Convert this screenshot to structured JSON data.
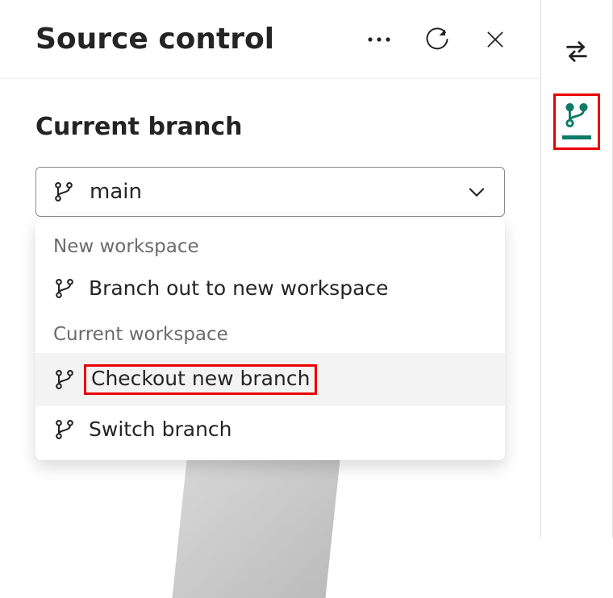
{
  "header": {
    "title": "Source control"
  },
  "section": {
    "heading": "Current branch"
  },
  "dropdown": {
    "value": "main",
    "groups": [
      {
        "label": "New workspace",
        "items": [
          {
            "label": "Branch out to new workspace",
            "highlighted": false
          }
        ]
      },
      {
        "label": "Current workspace",
        "items": [
          {
            "label": "Checkout new branch",
            "highlighted": true
          },
          {
            "label": "Switch branch",
            "highlighted": false
          }
        ]
      }
    ]
  },
  "colors": {
    "highlight_border": "#eb0000",
    "teal_icon": "#0d7b66"
  }
}
